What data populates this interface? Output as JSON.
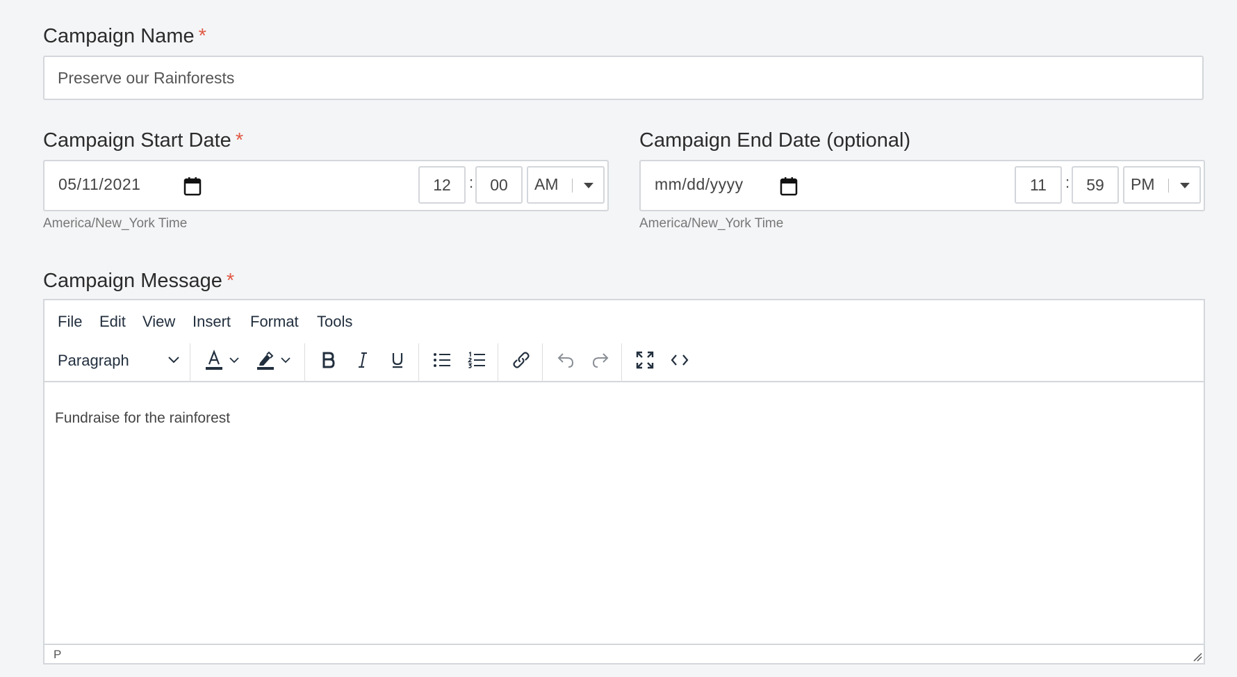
{
  "campaign_name": {
    "label": "Campaign Name",
    "required_mark": "*",
    "value": "Preserve our Rainforests"
  },
  "start_date": {
    "label": "Campaign Start Date",
    "required_mark": "*",
    "date_value": "05/11/2021",
    "hour": "12",
    "colon": ":",
    "minute": "00",
    "ampm": "AM",
    "timezone": "America/New_York Time"
  },
  "end_date": {
    "label": "Campaign End Date (optional)",
    "date_placeholder": "mm/dd/yyyy",
    "hour": "11",
    "colon": ":",
    "minute": "59",
    "ampm": "PM",
    "timezone": "America/New_York Time"
  },
  "message": {
    "label": "Campaign Message",
    "required_mark": "*",
    "menu": [
      "File",
      "Edit",
      "View",
      "Insert",
      "Format",
      "Tools"
    ],
    "block_format": "Paragraph",
    "toolbar_icons": [
      "text-color-icon",
      "highlight-color-icon",
      "bold-icon",
      "italic-icon",
      "underline-icon",
      "bullet-list-icon",
      "numbered-list-icon",
      "link-icon",
      "undo-icon",
      "redo-icon",
      "fullscreen-icon",
      "source-code-icon"
    ],
    "body_text": "Fundraise for the rainforest",
    "status_path": "P"
  },
  "colors": {
    "required": "#e05a45",
    "page_background": "#f4f5f7",
    "border": "#d3d6da",
    "toolbar_text": "#222f3e"
  }
}
